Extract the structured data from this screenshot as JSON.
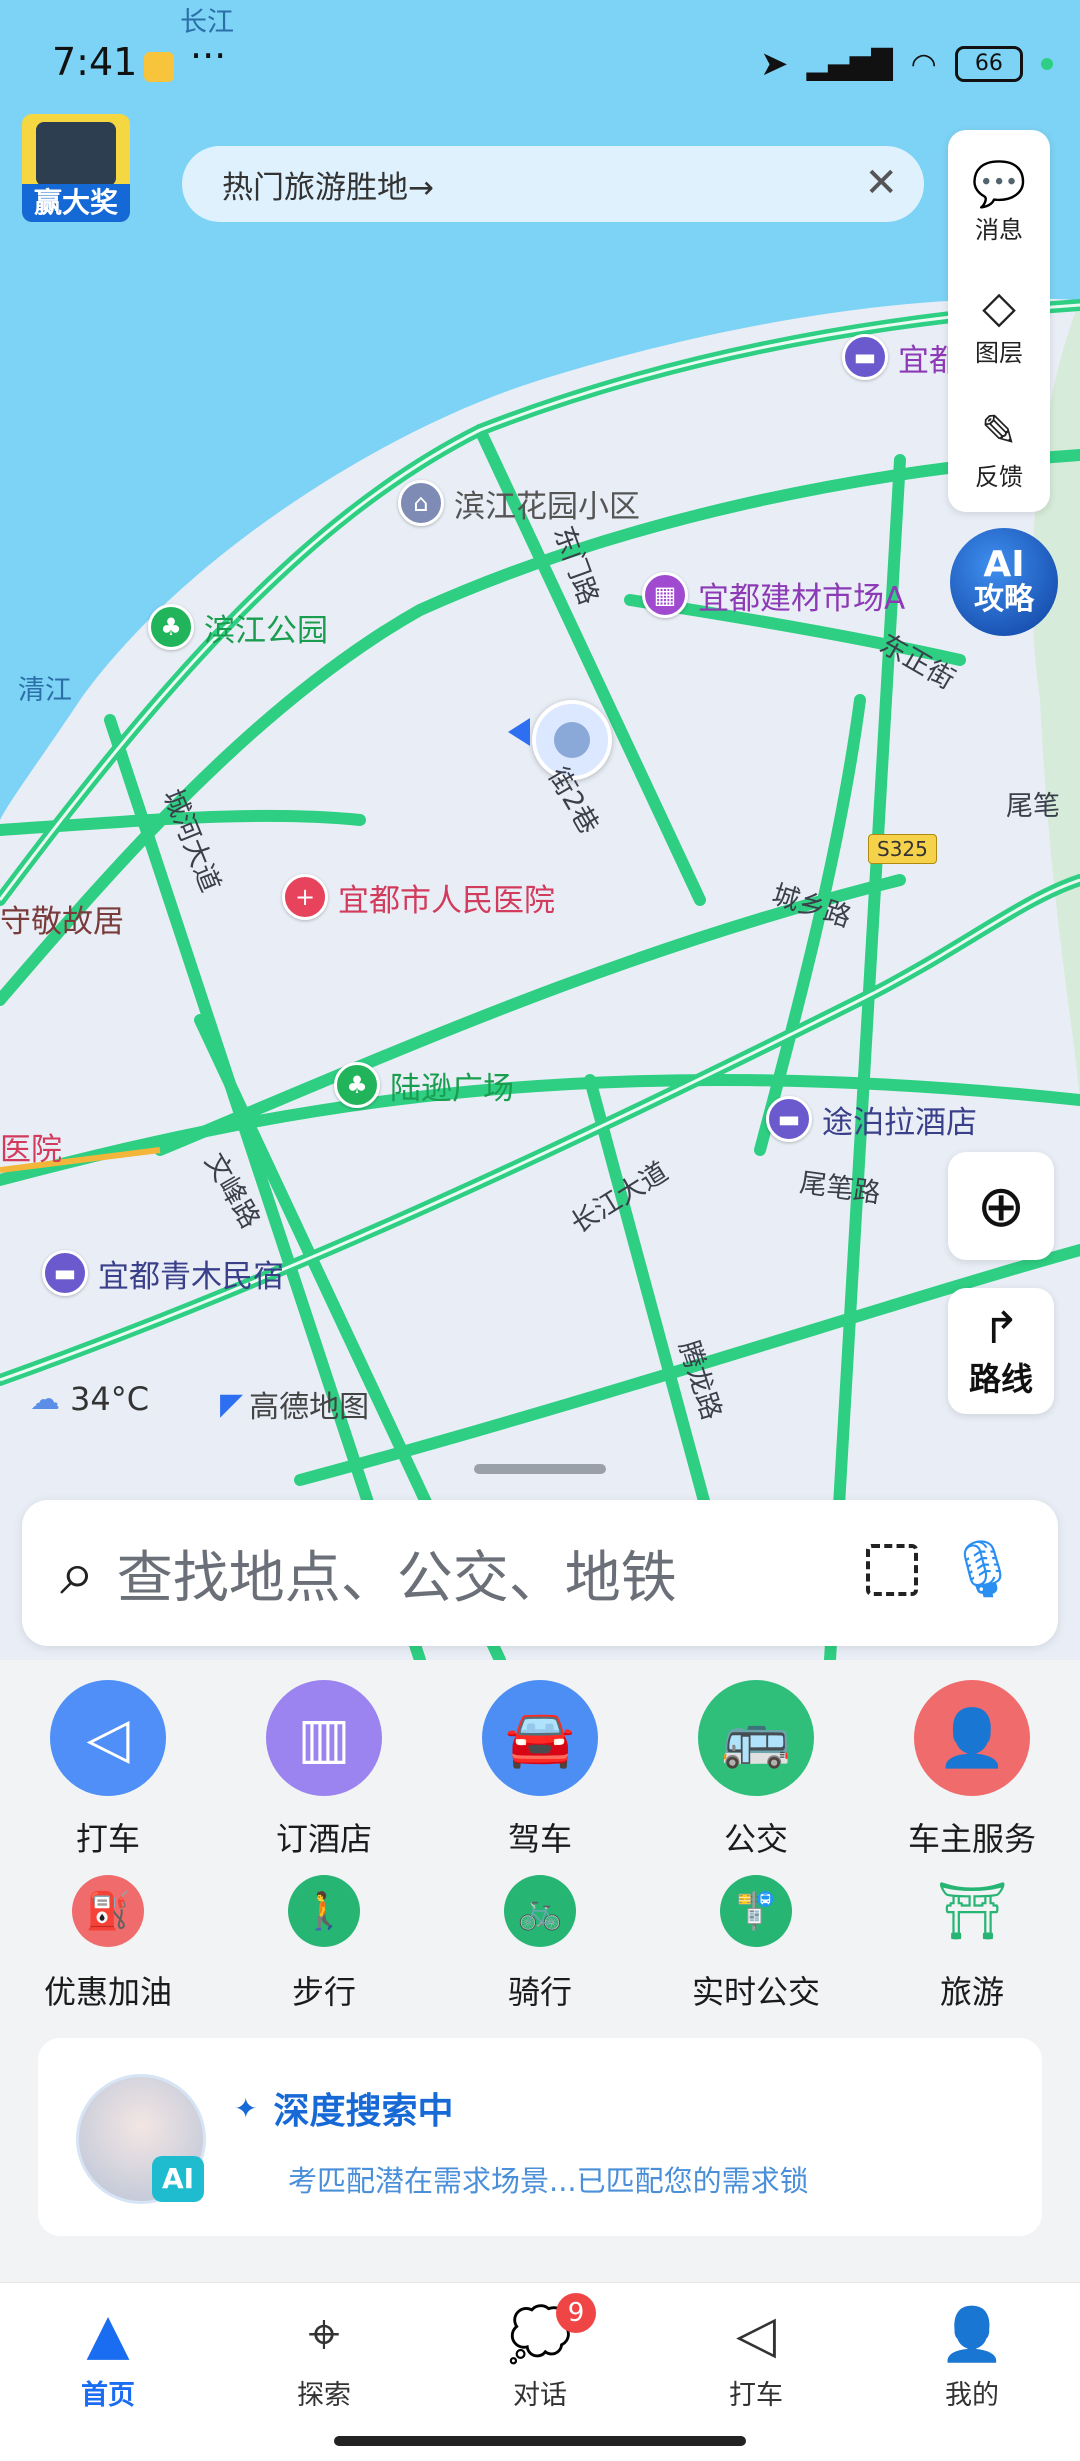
{
  "status_bar": {
    "time": "7:41",
    "dots": "···",
    "battery": "66"
  },
  "ad": {
    "label": "赢大奖"
  },
  "banner": {
    "text": "热门旅游胜地→"
  },
  "side_panel": {
    "message": "消息",
    "layers": "图层",
    "feedback": "反馈"
  },
  "ai_badge": {
    "line1": "AI",
    "line2": "攻略"
  },
  "route_button": {
    "label": "路线"
  },
  "map": {
    "labels": {
      "changjiang_top": "长江",
      "qingjiang": "清江",
      "binjiang_garden": "滨江花园小区",
      "binjiang_park": "滨江公园",
      "building_market": "宜都建材市场A",
      "hotel_top": "宜都假",
      "dongmen_rd": "东门路",
      "dongzheng_st": "东正街",
      "weibi": "尾笔",
      "s325": "S325",
      "chenghe_rd": "城河大道",
      "hospital": "宜都市人民医院",
      "chengxiang_rd": "城乡路",
      "shoujing": "守敬故居",
      "luxun_square": "陆逊广场",
      "tubo_hotel": "途泊拉酒店",
      "hospital_left": "医院",
      "wenfeng_rd": "文峰路",
      "changjiang_ave": "长江大道",
      "weibi_rd": "尾笔路",
      "qingmu": "宜都青木民宿",
      "tenglong_rd": "腾龙路",
      "jie2": "街2巷"
    },
    "weather": "34°C",
    "logo": "高德地图"
  },
  "search": {
    "placeholder": "查找地点、公交、地铁"
  },
  "services_main": [
    {
      "label": "打车",
      "color": "#4f8ff7"
    },
    {
      "label": "订酒店",
      "color": "#9b84f0"
    },
    {
      "label": "驾车",
      "color": "#4d8ef5"
    },
    {
      "label": "公交",
      "color": "#2fbf7a"
    },
    {
      "label": "车主服务",
      "color": "#f06b6b"
    }
  ],
  "services_sub": [
    {
      "label": "优惠加油",
      "color": "#f06b6b"
    },
    {
      "label": "步行",
      "color": "#27b574"
    },
    {
      "label": "骑行",
      "color": "#27b574"
    },
    {
      "label": "实时公交",
      "color": "#27b574"
    },
    {
      "label": "旅游",
      "color": "#27b574"
    }
  ],
  "deep_search": {
    "title": "深度搜索中",
    "text": "考匹配潜在需求场景...已匹配您的需求锁",
    "ai_tag": "AI"
  },
  "tabbar": {
    "home": "首页",
    "explore": "探索",
    "chat": "对话",
    "chat_badge": "9",
    "taxi": "打车",
    "mine": "我的"
  }
}
